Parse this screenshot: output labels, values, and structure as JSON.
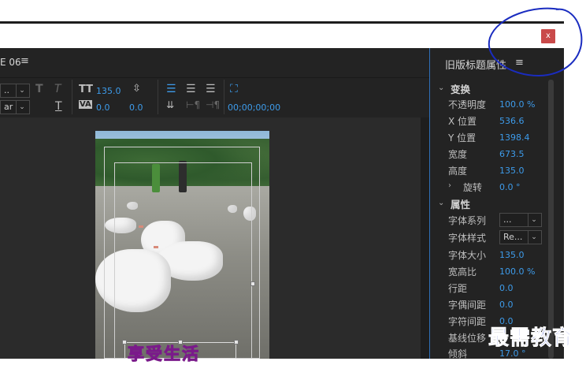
{
  "window": {
    "close_label": "x"
  },
  "editor": {
    "tab_label": "E 06",
    "tab_menu": "≡",
    "toolbar": {
      "font_family_value": "..",
      "font_style_value": "ar",
      "bold_glyph": "T",
      "italic_glyph": "T",
      "underline_glyph": "T",
      "font_size_glyph": "TT",
      "font_size_value": "135.0",
      "kerning_glyph": "VA",
      "kerning_value": "0.0",
      "leading_value": "0.0",
      "timecode": "00;00;00;00"
    },
    "title_text": "享受生活"
  },
  "properties": {
    "title": "旧版标题属性",
    "menu": "≡",
    "transform_header": "变换",
    "rows_transform": [
      {
        "label": "不透明度",
        "value": "100.0 %"
      },
      {
        "label": "X 位置",
        "value": "536.6"
      },
      {
        "label": "Y 位置",
        "value": "1398.4"
      },
      {
        "label": "宽度",
        "value": "673.5"
      },
      {
        "label": "高度",
        "value": "135.0"
      },
      {
        "label": "旋转",
        "value": "0.0 °"
      }
    ],
    "props_header": "属性",
    "font_family_label": "字体系列",
    "font_family_value": "...",
    "font_style_label": "字体样式",
    "font_style_value": "Re...",
    "rows_props": [
      {
        "label": "字体大小",
        "value": "135.0"
      },
      {
        "label": "宽高比",
        "value": "100.0 %"
      },
      {
        "label": "行距",
        "value": "0.0"
      },
      {
        "label": "字偶间距",
        "value": "0.0"
      },
      {
        "label": "字符间距",
        "value": "0.0"
      },
      {
        "label": "基线位移",
        "value": ""
      },
      {
        "label": "倾斜",
        "value": "17.0 °"
      }
    ]
  },
  "watermark": "最需教育",
  "colors": {
    "accent_blue": "#3d9bea",
    "panel_bg": "#232323",
    "close_red": "#c94a4a",
    "title_magenta": "#c12bd4",
    "scribble_blue": "#1a2cc0"
  }
}
